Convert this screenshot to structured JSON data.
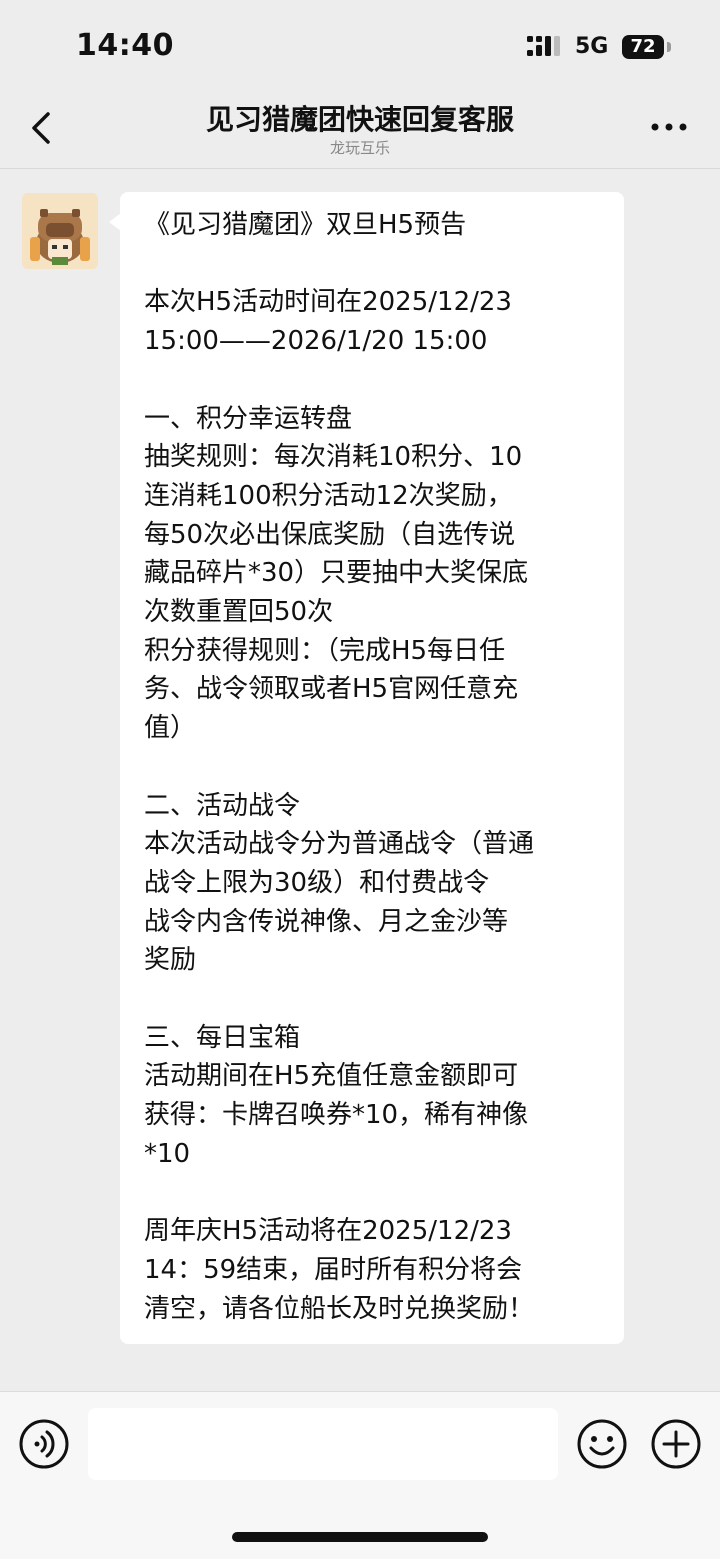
{
  "status_bar": {
    "time": "14:40",
    "network": "5G",
    "battery": "72"
  },
  "nav": {
    "title": "见习猎魔团快速回复客服",
    "subtitle": "龙玩互乐",
    "back_icon": "chevron-left-icon",
    "more_icon": "more-dots-icon"
  },
  "message": {
    "sender": "received",
    "text": "《见习猎魔团》双旦H5预告\n\n本次H5活动时间在2025/12/23\n15:00——2026/1/20 15:00\n\n一、积分幸运转盘\n抽奖规则：每次消耗10积分、10\n连消耗100积分活动12次奖励，\n每50次必出保底奖励（自选传说\n藏品碎片*30）只要抽中大奖保底\n次数重置回50次\n积分获得规则：（完成H5每日任\n务、战令领取或者H5官网任意充\n值）\n\n二、活动战令\n本次活动战令分为普通战令（普通\n战令上限为30级）和付费战令\n战令内含传说神像、月之金沙等\n奖励\n\n三、每日宝箱\n活动期间在H5充值任意金额即可\n获得：卡牌召唤券*10，稀有神像\n*10\n\n周年庆H5活动将在2025/12/23\n14：59结束，届时所有积分将会\n清空，请各位船长及时兑换奖励！"
  },
  "input_bar": {
    "placeholder": "",
    "voice_icon": "voice-icon",
    "emoji_icon": "emoji-icon",
    "plus_icon": "plus-icon"
  },
  "colors": {
    "background": "#ededed",
    "bubble": "#ffffff",
    "text": "#111111",
    "subtitle": "#888888"
  }
}
